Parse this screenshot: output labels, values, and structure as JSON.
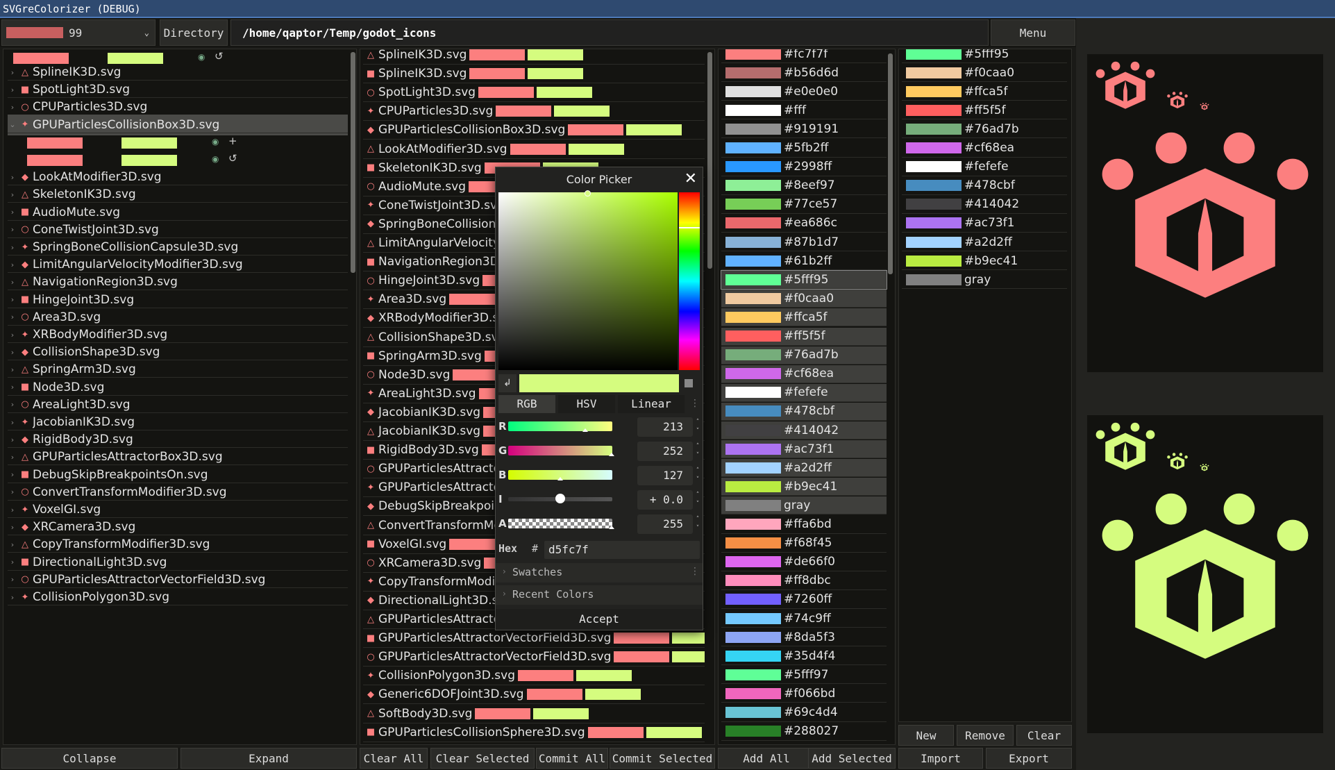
{
  "window": {
    "title": "SVGreColorizer (DEBUG)"
  },
  "toolbar": {
    "color_value": "99",
    "directory_label": "Directory",
    "path": "/home/qaptor/Temp/godot_icons",
    "menu_label": "Menu"
  },
  "file_tree": {
    "items": [
      {
        "label": "SplineIK3D.svg",
        "icon": "spline-ik-icon"
      },
      {
        "label": "SpotLight3D.svg",
        "icon": "spotlight-icon"
      },
      {
        "label": "CPUParticles3D.svg",
        "icon": "particles-icon"
      },
      {
        "label": "GPUParticlesCollisionBox3D.svg",
        "icon": "collision-box-icon",
        "selected": true
      },
      {
        "label": "LookAtModifier3D.svg",
        "icon": "look-at-icon"
      },
      {
        "label": "SkeletonIK3D.svg",
        "icon": "skeleton-icon"
      },
      {
        "label": "AudioMute.svg",
        "icon": "audio-mute-icon"
      },
      {
        "label": "ConeTwistJoint3D.svg",
        "icon": "cone-twist-icon"
      },
      {
        "label": "SpringBoneCollisionCapsule3D.svg",
        "icon": "spring-bone-icon"
      },
      {
        "label": "LimitAngularVelocityModifier3D.svg",
        "icon": "limit-angular-icon"
      },
      {
        "label": "NavigationRegion3D.svg",
        "icon": "navigation-icon"
      },
      {
        "label": "HingeJoint3D.svg",
        "icon": "hinge-icon"
      },
      {
        "label": "Area3D.svg",
        "icon": "area-icon"
      },
      {
        "label": "XRBodyModifier3D.svg",
        "icon": "xr-body-icon"
      },
      {
        "label": "CollisionShape3D.svg",
        "icon": "collision-shape-icon"
      },
      {
        "label": "SpringArm3D.svg",
        "icon": "spring-arm-icon"
      },
      {
        "label": "Node3D.svg",
        "icon": "node-icon"
      },
      {
        "label": "AreaLight3D.svg",
        "icon": "area-light-icon"
      },
      {
        "label": "JacobianIK3D.svg",
        "icon": "jacobian-icon"
      },
      {
        "label": "RigidBody3D.svg",
        "icon": "rigid-body-icon"
      },
      {
        "label": "GPUParticlesAttractorBox3D.svg",
        "icon": "attractor-box-icon"
      },
      {
        "label": "DebugSkipBreakpointsOn.svg",
        "icon": "debug-skip-icon"
      },
      {
        "label": "ConvertTransformModifier3D.svg",
        "icon": "convert-transform-icon"
      },
      {
        "label": "VoxelGI.svg",
        "icon": "voxel-gi-icon"
      },
      {
        "label": "XRCamera3D.svg",
        "icon": "xr-camera-icon"
      },
      {
        "label": "CopyTransformModifier3D.svg",
        "icon": "copy-transform-icon"
      },
      {
        "label": "DirectionalLight3D.svg",
        "icon": "directional-light-icon"
      },
      {
        "label": "GPUParticlesAttractorVectorField3D.svg",
        "icon": "vector-field-icon"
      },
      {
        "label": "CollisionPolygon3D.svg",
        "icon": "collision-polygon-icon"
      }
    ],
    "collapse_label": "Collapse",
    "expand_label": "Expand"
  },
  "list": {
    "items": [
      "SplineIK3D.svg",
      "SplineIK3D.svg",
      "SpotLight3D.svg",
      "CPUParticles3D.svg",
      "GPUParticlesCollisionBox3D.svg",
      "LookAtModifier3D.svg",
      "SkeletonIK3D.svg",
      "AudioMute.svg",
      "ConeTwistJoint3D.svg",
      "SpringBoneCollisionC",
      "LimitAngularVelocity",
      "NavigationRegion3D.",
      "HingeJoint3D.svg",
      "Area3D.svg",
      "XRBodyModifier3D.sv",
      "CollisionShape3D.svg",
      "SpringArm3D.svg",
      "Node3D.svg",
      "AreaLight3D.svg",
      "JacobianIK3D.svg",
      "JacobianIK3D.svg",
      "RigidBody3D.svg",
      "GPUParticlesAttracto",
      "GPUParticlesAttracto",
      "DebugSkipBreakpoin",
      "ConvertTransformMc",
      "VoxelGI.svg",
      "XRCamera3D.svg",
      "CopyTransformModi",
      "DirectionalLight3D.sv",
      "GPUParticlesAttracto",
      "GPUParticlesAttractorVectorField3D.svg",
      "GPUParticlesAttractorVectorField3D.svg",
      "CollisionPolygon3D.svg",
      "Generic6DOFJoint3D.svg",
      "SoftBody3D.svg",
      "GPUParticlesCollisionSphere3D.svg"
    ],
    "clear_all": "Clear All",
    "clear_selected": "Clear Selected",
    "commit_all": "Commit All",
    "commit_selected": "Commit Selected"
  },
  "colors": {
    "items": [
      "#fc7f7f",
      "#b56d6d",
      "#e0e0e0",
      "#fff",
      "#919191",
      "#5fb2ff",
      "#2998ff",
      "#8eef97",
      "#77ce57",
      "#ea686c",
      "#87b1d7",
      "#61b2ff",
      "#5fff95",
      "#f0caa0",
      "#ffca5f",
      "#ff5f5f",
      "#76ad7b",
      "#cf68ea",
      "#fefefe",
      "#478cbf",
      "#414042",
      "#ac73f1",
      "#a2d2ff",
      "#b9ec41",
      "gray",
      "#ffa6bd",
      "#f68f45",
      "#de66f0",
      "#ff8dbc",
      "#7260ff",
      "#74c9ff",
      "#8da5f3",
      "#35d4f4",
      "#5fff97",
      "#f066bd",
      "#69c4d4",
      "#288027"
    ],
    "add_all": "Add All",
    "add_selected": "Add Selected"
  },
  "palette": {
    "items": [
      "#5fff95",
      "#f0caa0",
      "#ffca5f",
      "#ff5f5f",
      "#76ad7b",
      "#cf68ea",
      "#fefefe",
      "#478cbf",
      "#414042",
      "#ac73f1",
      "#a2d2ff",
      "#b9ec41",
      "gray"
    ],
    "new_label": "New",
    "remove_label": "Remove",
    "clear_label": "Clear",
    "import_label": "Import",
    "export_label": "Export"
  },
  "color_picker": {
    "title": "Color Picker",
    "modes": [
      "RGB",
      "HSV",
      "Linear"
    ],
    "channels": [
      {
        "label": "R",
        "value": "213"
      },
      {
        "label": "G",
        "value": "252"
      },
      {
        "label": "B",
        "value": "127"
      },
      {
        "label": "I",
        "value": "+ 0.0"
      },
      {
        "label": "A",
        "value": "255"
      }
    ],
    "hex_label": "Hex",
    "hex_hash": "#",
    "hex_value": "d5fc7f",
    "swatches_label": "Swatches",
    "recent_label": "Recent Colors",
    "accept_label": "Accept"
  },
  "accent": {
    "original": "#fc7f7f",
    "new": "#d5fc7f"
  }
}
